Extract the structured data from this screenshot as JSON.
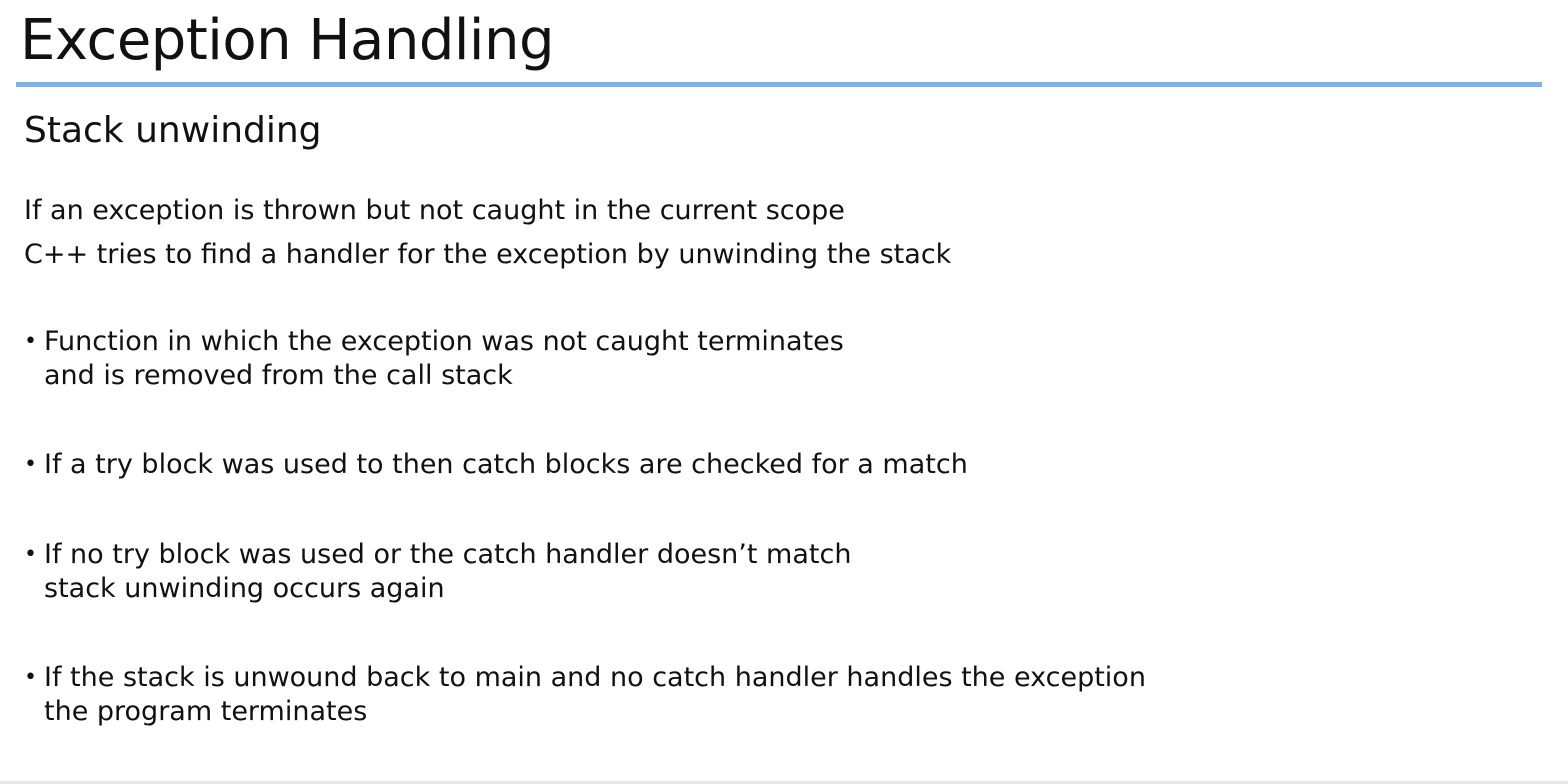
{
  "slide": {
    "title": "Exception Handling",
    "accent_color": "#7fb2e5",
    "subtitle": "Stack unwinding",
    "intro": [
      "If an exception is thrown but not caught in the current scope",
      "C++ tries to find a handler for the exception by unwinding the stack"
    ],
    "bullet_symbol": "•",
    "bullets": [
      {
        "lines": [
          "Function in which the exception was not caught terminates",
          "and is removed from the call stack"
        ]
      },
      {
        "lines": [
          "If a try block was used to then catch blocks are checked for a match"
        ]
      },
      {
        "lines": [
          "If no try block was used or the catch handler doesn’t match",
          "stack unwinding occurs again"
        ]
      },
      {
        "lines": [
          "If the stack is unwound back to main and no catch handler handles the exception",
          "the program terminates"
        ]
      }
    ]
  }
}
